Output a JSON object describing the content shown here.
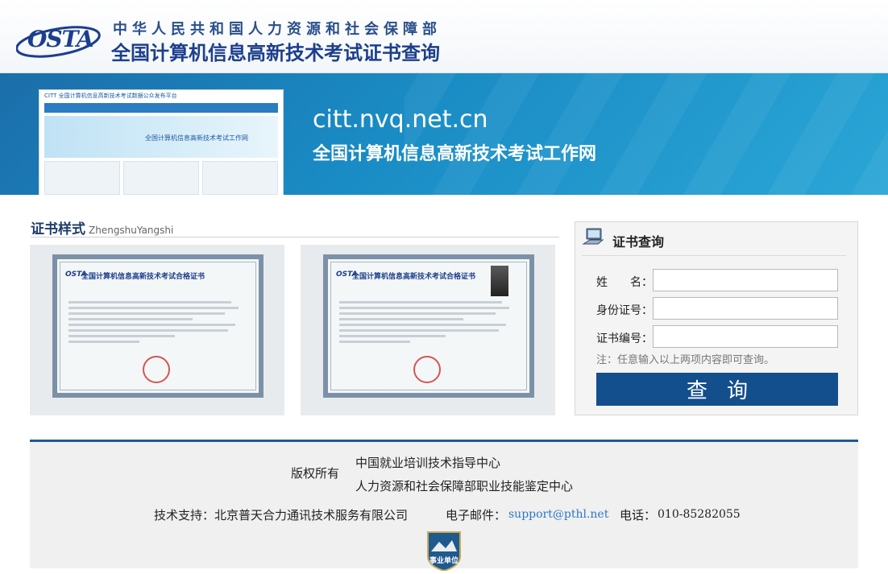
{
  "header": {
    "logo_text": "OSTA",
    "line1": "中华人民共和国人力资源和社会保障部",
    "line2": "全国计算机信息高新技术考试证书查询"
  },
  "banner": {
    "site_url": "citt.nvq.net.cn",
    "site_title": "全国计算机信息高新技术考试工作网",
    "screenshot_caption": "CITT 全国计算机信息高新技术考试数据公众发布平台",
    "screenshot_hero": "全国计算机信息高新技术考试工作网"
  },
  "certificates": {
    "section_title": "证书样式",
    "section_subtitle": "ZhengshuYangshi",
    "cert_heading": "全国计算机信息高新技术考试合格证书"
  },
  "query": {
    "title": "证书查询",
    "name_label": "姓　　名：",
    "id_label": "身份证号：",
    "cert_label": "证书编号：",
    "name_value": "",
    "id_value": "",
    "cert_value": "",
    "note": "注：任意输入以上两项内容即可查询。",
    "submit_label": "查询"
  },
  "footer": {
    "copyright_label": "版权所有",
    "org1": "中国就业培训技术指导中心",
    "org2": "人力资源和社会保障部职业技能鉴定中心",
    "support": "技术支持：北京普天合力通讯技术服务有限公司",
    "email_label": "电子邮件：",
    "email": "support@pthl.net",
    "phone_label": "电话：",
    "phone": "010-85282055",
    "badge_text": "事业单位"
  },
  "colors": {
    "brand_blue": "#1c3f8c",
    "button_blue": "#134f8d",
    "banner_blue": "#1a8cc5",
    "link_blue": "#2c77c5"
  }
}
